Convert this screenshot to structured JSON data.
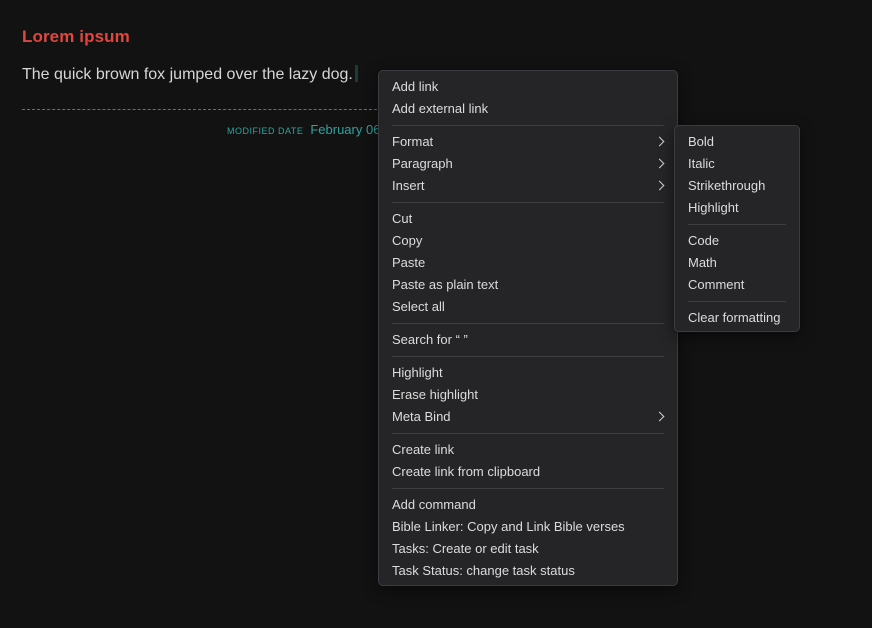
{
  "note": {
    "title": "Lorem ipsum",
    "body": "The quick brown fox jumped over the lazy dog.",
    "modified_label": "MODIFIED DATE",
    "modified_value": "February 06"
  },
  "context_menu": {
    "groups": [
      [
        {
          "label": "Add link",
          "submenu": false
        },
        {
          "label": "Add external link",
          "submenu": false
        }
      ],
      [
        {
          "label": "Format",
          "submenu": true
        },
        {
          "label": "Paragraph",
          "submenu": true
        },
        {
          "label": "Insert",
          "submenu": true
        }
      ],
      [
        {
          "label": "Cut",
          "submenu": false
        },
        {
          "label": "Copy",
          "submenu": false
        },
        {
          "label": "Paste",
          "submenu": false
        },
        {
          "label": "Paste as plain text",
          "submenu": false
        },
        {
          "label": "Select all",
          "submenu": false
        }
      ],
      [
        {
          "label": "Search for “ ”",
          "submenu": false
        }
      ],
      [
        {
          "label": "Highlight",
          "submenu": false
        },
        {
          "label": "Erase highlight",
          "submenu": false
        },
        {
          "label": "Meta Bind",
          "submenu": true
        }
      ],
      [
        {
          "label": "Create link",
          "submenu": false
        },
        {
          "label": "Create link from clipboard",
          "submenu": false
        }
      ],
      [
        {
          "label": "Add command",
          "submenu": false
        },
        {
          "label": "Bible Linker: Copy and Link Bible verses",
          "submenu": false
        },
        {
          "label": "Tasks: Create or edit task",
          "submenu": false
        },
        {
          "label": "Task Status: change task status",
          "submenu": false
        }
      ]
    ]
  },
  "format_submenu": {
    "groups": [
      [
        {
          "label": "Bold"
        },
        {
          "label": "Italic"
        },
        {
          "label": "Strikethrough"
        },
        {
          "label": "Highlight"
        }
      ],
      [
        {
          "label": "Code"
        },
        {
          "label": "Math"
        },
        {
          "label": "Comment"
        }
      ],
      [
        {
          "label": "Clear formatting"
        }
      ]
    ]
  },
  "colors": {
    "title": "#e0473f",
    "accent": "#2fa39d",
    "menu_bg": "#252528",
    "page_bg": "#121212"
  }
}
